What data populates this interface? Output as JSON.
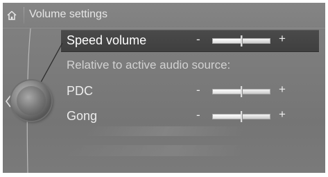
{
  "header": {
    "title": "Volume settings",
    "home_icon": "home-icon"
  },
  "menu": {
    "items": [
      {
        "label": "Speed volume",
        "minus": "-",
        "plus": "+",
        "level": 0.5,
        "selected": true
      },
      {
        "label": "PDC",
        "minus": "-",
        "plus": "+",
        "level": 0.5,
        "selected": false
      },
      {
        "label": "Gong",
        "minus": "-",
        "plus": "+",
        "level": 0.5,
        "selected": false
      }
    ],
    "section_label": "Relative to active audio source:"
  },
  "controller": {
    "icon": "controller-knob-icon",
    "arrow_icon": "chevron-left-icon"
  },
  "colors": {
    "background": "#7b7b7b",
    "selection": "#444444",
    "text": "#ececec"
  }
}
